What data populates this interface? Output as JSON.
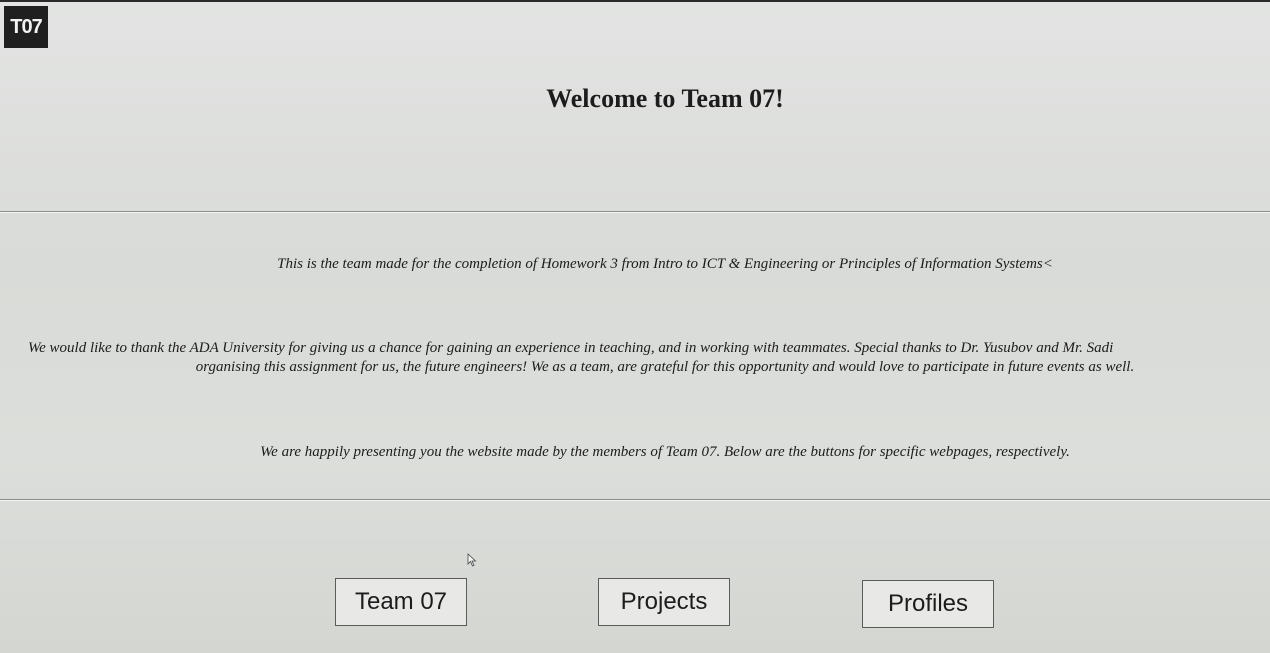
{
  "logo": {
    "text": "T07"
  },
  "header": {
    "title": "Welcome to Team 07!"
  },
  "content": {
    "intro": "This is the team made for the completion of Homework 3 from Intro to ICT & Engineering or Principles of Information Systems<",
    "thanks_line1": "We would like to thank the ADA University for giving us a chance for gaining an experience in teaching, and in working with teammates. Special thanks to Dr. Yusubov and Mr. Sadi",
    "thanks_line2": "organising this assignment for us, the future engineers! We as a team, are grateful for this opportunity and would love to participate in future events as well.",
    "presenting": "We are happily presenting you the website made by the members of Team 07. Below are the buttons for specific webpages, respectively."
  },
  "nav": {
    "team_label": "Team 07",
    "projects_label": "Projects",
    "profiles_label": "Profiles"
  },
  "icons": {
    "cursor": "mouse-pointer-icon"
  }
}
